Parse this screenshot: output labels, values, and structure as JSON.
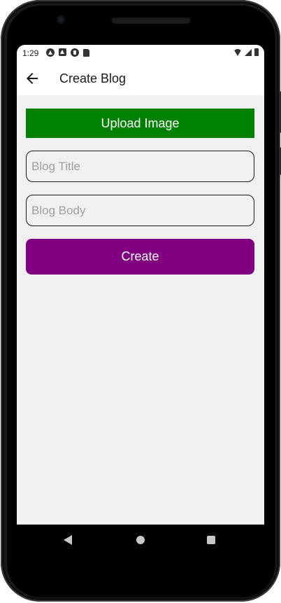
{
  "status_bar": {
    "time": "1:29",
    "left_icons": [
      "android-auto-icon",
      "app-store-icon",
      "play-icon",
      "sd-card-icon"
    ],
    "right_icons": [
      "wifi-icon",
      "cellular-signal-icon",
      "battery-icon"
    ]
  },
  "app_bar": {
    "back_icon": "arrow-left-icon",
    "title": "Create Blog"
  },
  "form": {
    "upload_label": "Upload Image",
    "title_placeholder": "Blog Title",
    "title_value": "",
    "body_placeholder": "Blog Body",
    "body_value": "",
    "create_label": "Create"
  },
  "colors": {
    "upload_button": "#008000",
    "create_button": "#800080",
    "screen_background": "#f0f0f0"
  },
  "nav_bar": {
    "icons": [
      "nav-back-icon",
      "nav-home-icon",
      "nav-recents-icon"
    ]
  }
}
